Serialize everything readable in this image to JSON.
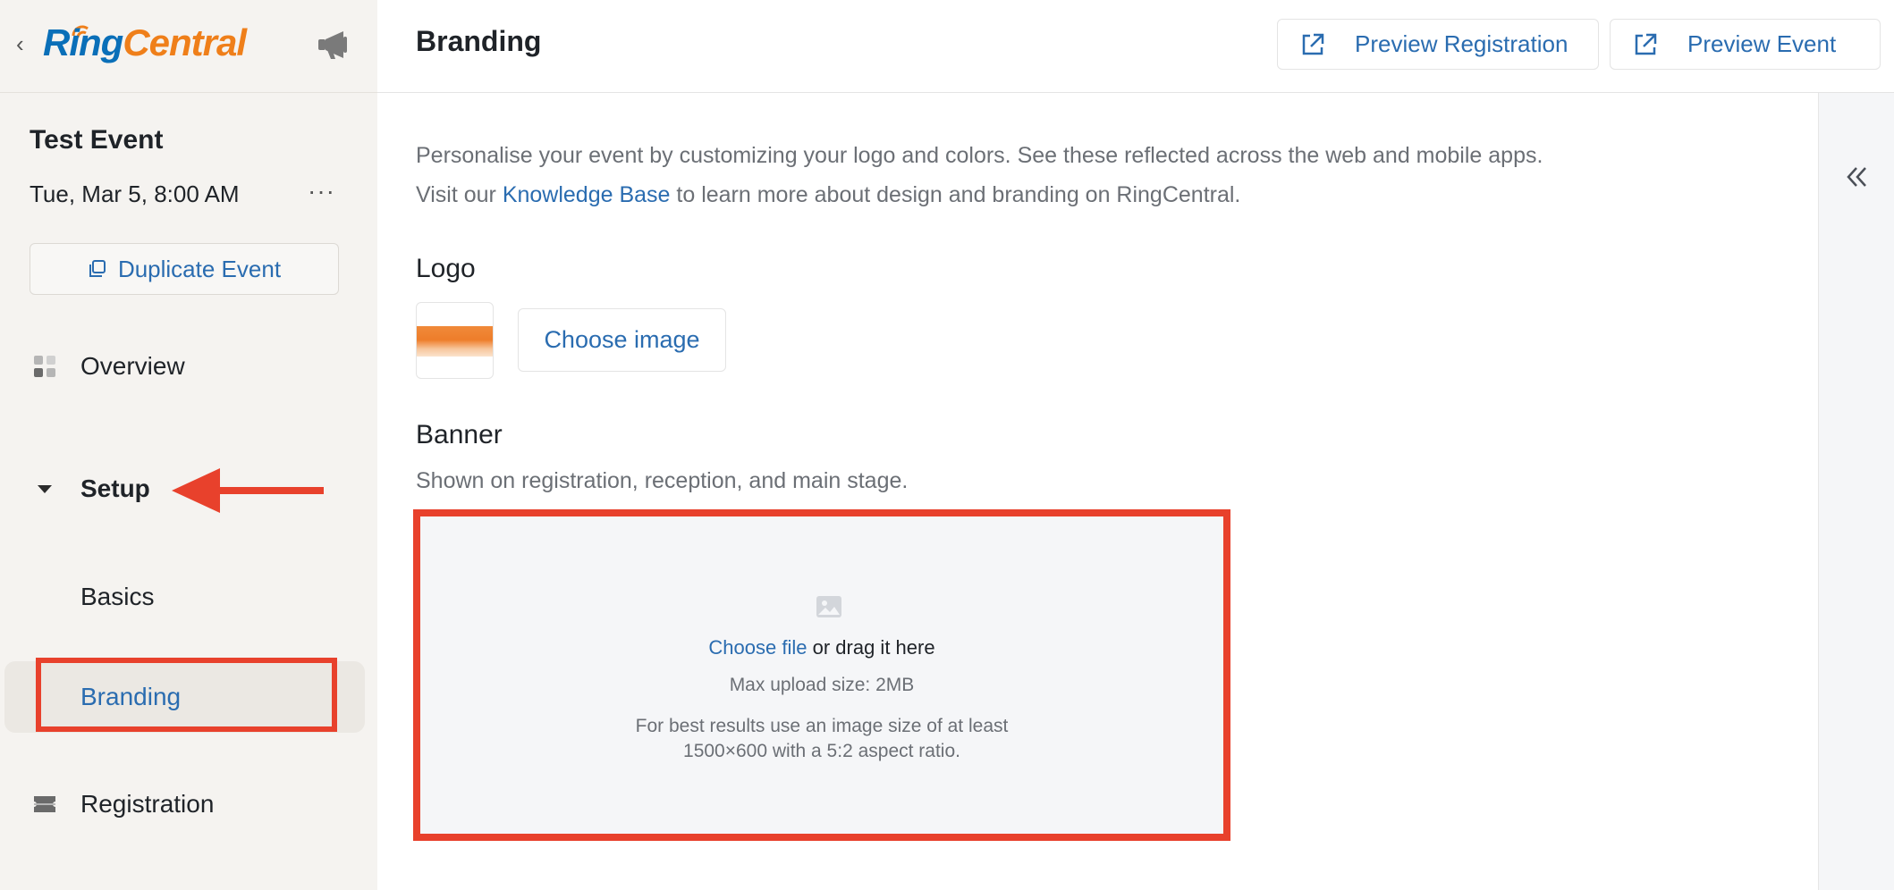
{
  "sidebar": {
    "logo": {
      "ring": "Ring",
      "central": "Central"
    },
    "event": {
      "title": "Test Event",
      "date": "Tue, Mar 5, 8:00 AM",
      "more": "···",
      "duplicate_label": "Duplicate Event"
    },
    "nav": {
      "overview": "Overview",
      "setup": "Setup",
      "basics": "Basics",
      "branding": "Branding",
      "registration": "Registration"
    }
  },
  "header": {
    "title": "Branding",
    "preview_registration": "Preview Registration",
    "preview_event": "Preview Event"
  },
  "main": {
    "intro_line1": "Personalise your event by customizing your logo and colors. See these reflected across the web and mobile apps.",
    "intro_visit": "Visit our ",
    "intro_kb": "Knowledge Base",
    "intro_rest": " to learn more about design and branding on RingCentral.",
    "logo_section": {
      "title": "Logo",
      "choose_image": "Choose image"
    },
    "banner_section": {
      "title": "Banner",
      "subtitle": "Shown on registration, reception, and main stage.",
      "choose_file": "Choose file",
      "drag_text": " or drag it here",
      "max_upload": "Max upload size: 2MB",
      "best_results_1": "For best results use an image size of at least",
      "best_results_2": "1500×600 with a 5:2 aspect ratio."
    }
  },
  "colors": {
    "accent_blue": "#2a6cb0",
    "annotation_red": "#e8412c",
    "brand_orange": "#ef7f1a",
    "brand_blue": "#0a6fb8",
    "sidebar_bg": "#f5f3f0"
  }
}
